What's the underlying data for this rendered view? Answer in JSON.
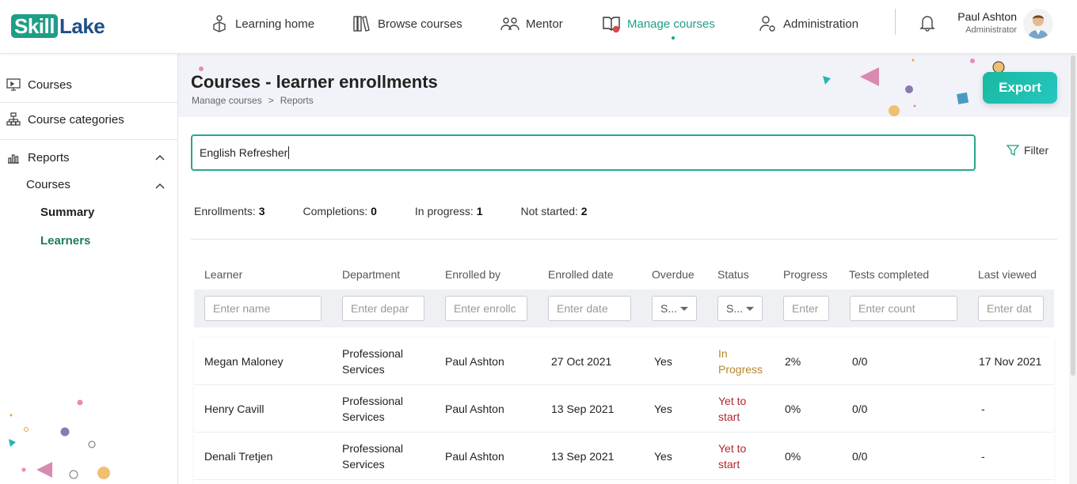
{
  "app": {
    "logo_part1": "Skill",
    "logo_part2": "Lake"
  },
  "nav": {
    "items": [
      {
        "label": "Learning home",
        "icon": "learning-home-icon"
      },
      {
        "label": "Browse courses",
        "icon": "books-icon"
      },
      {
        "label": "Mentor",
        "icon": "mentor-icon"
      },
      {
        "label": "Manage courses",
        "icon": "manage-courses-icon",
        "active": true
      },
      {
        "label": "Administration",
        "icon": "admin-icon"
      }
    ]
  },
  "user": {
    "name": "Paul Ashton",
    "role": "Administrator"
  },
  "sidebar": {
    "items": [
      {
        "label": "Courses",
        "icon": "monitor-icon"
      },
      {
        "label": "Course categories",
        "icon": "hierarchy-icon"
      },
      {
        "label": "Reports",
        "icon": "chart-icon"
      }
    ],
    "sub_courses": "Courses",
    "sub_summary": "Summary",
    "sub_learners": "Learners"
  },
  "page": {
    "title": "Courses - learner enrollments",
    "breadcrumb": [
      "Manage courses",
      ">",
      "Reports"
    ],
    "export_label": "Export",
    "filter_label": "Filter"
  },
  "search": {
    "value": "English Refresher"
  },
  "stats": [
    {
      "label": "Enrollments:",
      "value": "3"
    },
    {
      "label": "Completions:",
      "value": "0"
    },
    {
      "label": "In progress:",
      "value": "1"
    },
    {
      "label": "Not started:",
      "value": "2"
    }
  ],
  "table": {
    "headers": [
      "Learner",
      "Department",
      "Enrolled by",
      "Enrolled date",
      "Overdue",
      "Status",
      "Progress",
      "Tests completed",
      "Last viewed"
    ],
    "filters": {
      "learner": "Enter name",
      "department": "Enter depar",
      "enrolled_by": "Enter enrollc",
      "enrolled_date": "Enter date",
      "overdue": "S...",
      "status": "S...",
      "progress": "Enter",
      "tests": "Enter count",
      "last_viewed": "Enter dat"
    },
    "rows": [
      {
        "learner": "Megan Maloney",
        "dept1": "Professional",
        "dept2": "Services",
        "enrolled_by": "Paul Ashton",
        "date": "27 Oct 2021",
        "overdue": "Yes",
        "status1": "In",
        "status2": "Progress",
        "status_kind": "progress",
        "progress": "2%",
        "tests": "0/0",
        "last_viewed": "17 Nov 2021"
      },
      {
        "learner": "Henry Cavill",
        "dept1": "Professional",
        "dept2": "Services",
        "enrolled_by": "Paul Ashton",
        "date": "13 Sep 2021",
        "overdue": "Yes",
        "status1": "Yet to",
        "status2": "start",
        "status_kind": "yet",
        "progress": "0%",
        "tests": "0/0",
        "last_viewed": "-"
      },
      {
        "learner": "Denali Tretjen",
        "dept1": "Professional",
        "dept2": "Services",
        "enrolled_by": "Paul Ashton",
        "date": "13 Sep 2021",
        "overdue": "Yes",
        "status1": "Yet to",
        "status2": "start",
        "status_kind": "yet",
        "progress": "0%",
        "tests": "0/0",
        "last_viewed": "-"
      }
    ]
  },
  "colors": {
    "accent": "#1f9e87",
    "brand_blue": "#1f4e8a",
    "status_in_progress": "#b8862a",
    "status_yet_to_start": "#b0282d"
  }
}
